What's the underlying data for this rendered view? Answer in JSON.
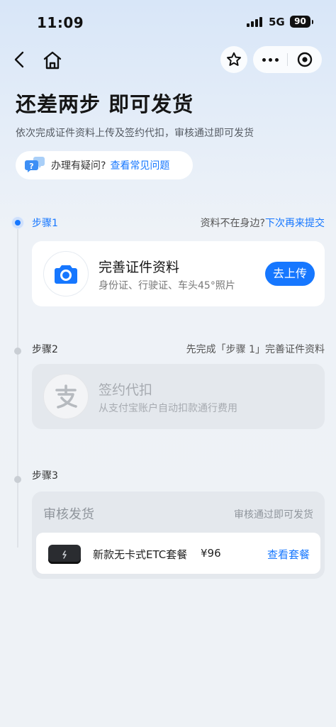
{
  "status_bar": {
    "time": "11:09",
    "network": "5G",
    "battery": "90"
  },
  "page": {
    "title": "还差两步 即可发货",
    "subtitle": "依次完成证件资料上传及签约代扣，审核通过即可发货",
    "help": {
      "question": "办理有疑问?",
      "link": "查看常见问题"
    }
  },
  "steps": [
    {
      "label": "步骤1",
      "right_text": "资料不在身边?",
      "right_link": "下次再来提交",
      "card": {
        "title": "完善证件资料",
        "subtitle": "身份证、行驶证、车头45°照片",
        "button": "去上传"
      }
    },
    {
      "label": "步骤2",
      "right_text": "先完成「步骤 1」完善证件资料",
      "card": {
        "title": "签约代扣",
        "subtitle": "从支付宝账户自动扣款通行费用"
      }
    },
    {
      "label": "步骤3",
      "card": {
        "title": "审核发货",
        "right_text": "审核通过即可发货",
        "package": {
          "name": "新款无卡式ETC套餐",
          "price": "¥96",
          "link": "查看套餐"
        }
      }
    }
  ],
  "colors": {
    "accent": "#1677ff",
    "disabled_card": "#e4e8ed"
  },
  "icons": [
    "back-icon",
    "home-icon",
    "star-icon",
    "more-icon",
    "close-target-icon",
    "help-chat-icon",
    "camera-icon",
    "alipay-icon",
    "etc-device-icon"
  ]
}
